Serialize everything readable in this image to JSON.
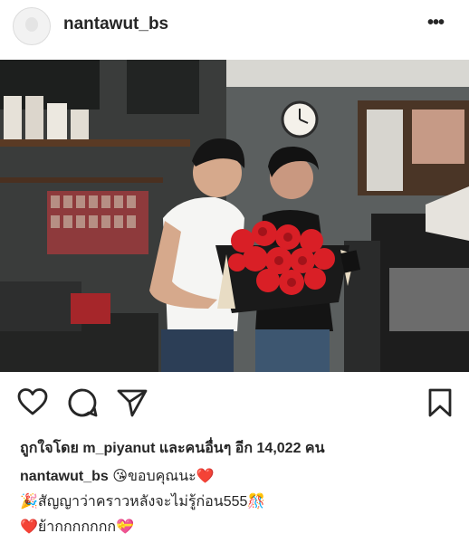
{
  "post": {
    "username": "nantawut_bs",
    "more_label": "•••"
  },
  "actions": {
    "icons": [
      "heart-icon",
      "comment-icon",
      "share-icon",
      "bookmark-icon"
    ]
  },
  "likes": {
    "prefix": "ถูกใจโดย",
    "user": "m_piyanut",
    "suffix": "และคนอื่นๆ อีก 14,022 คน"
  },
  "caption": {
    "username": "nantawut_bs",
    "line1_emoji": "😘",
    "line1_text": "ขอบคุณนะ",
    "line1_emoji_end": "❤️",
    "line2_emoji": "🎉",
    "line2_text": "สัญญาว่าคราวหลังจะไม่รู้ก่อน555",
    "line2_emoji_end": "🎊",
    "line3_emoji": "❤️",
    "line3_text": "ย้ากกกกกกก",
    "line3_emoji_end": "💝"
  },
  "colors": {
    "text": "#262626",
    "heart": "#e0245e",
    "roses": "#d91f26"
  }
}
